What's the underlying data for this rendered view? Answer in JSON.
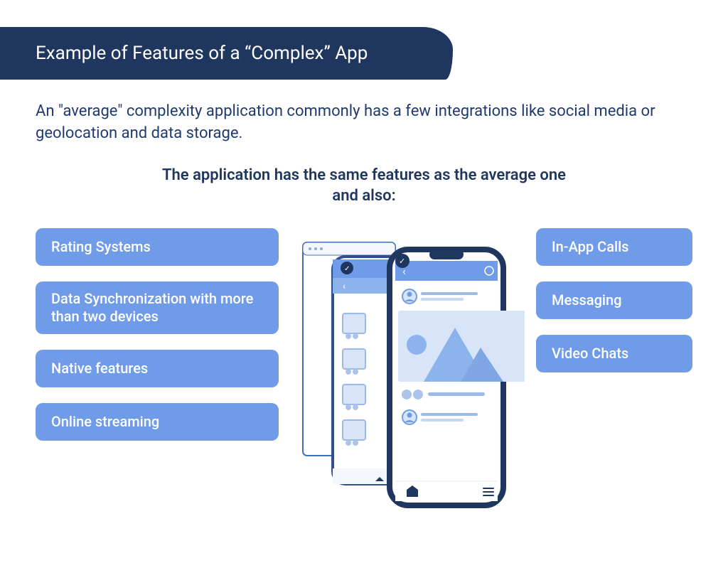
{
  "banner": {
    "title": "Example of Features of a “Complex” App"
  },
  "intro": "An \"average\" complexity application commonly has a few integrations like social media or geolocation and data storage.",
  "subhead_line1": "The application has the same features as the average one",
  "subhead_line2": "and also:",
  "features_left": [
    "Rating Systems",
    "Data Synchronization with more than two devices",
    "Native features",
    "Online streaming"
  ],
  "features_right": [
    "In-App Calls",
    "Messaging",
    "Video Chats"
  ],
  "colors": {
    "banner": "#1f365e",
    "pill": "#6f9be8",
    "text": "#1f3a6e"
  }
}
